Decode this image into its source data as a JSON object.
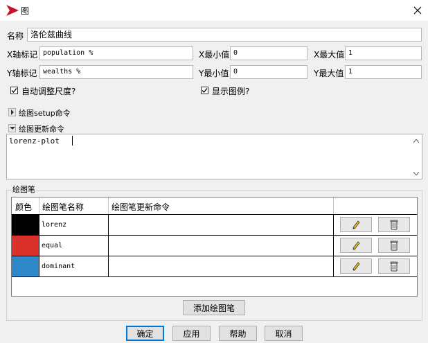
{
  "window": {
    "title": "图"
  },
  "form": {
    "name_label": "名称",
    "name_value": "洛伦兹曲线",
    "xlabel_label": "X轴标记",
    "xlabel_value": "population %",
    "xmin_label": "X最小值",
    "xmin_value": "0",
    "xmax_label": "X最大值",
    "xmax_value": "1",
    "ylabel_label": "Y轴标记",
    "ylabel_value": "wealths %",
    "ymin_label": "Y最小值",
    "ymin_value": "0",
    "ymax_label": "Y最大值",
    "ymax_value": "1",
    "autoscale_label": "自动调整尺度?",
    "autoscale_checked": true,
    "legend_label": "显示图例?",
    "legend_checked": true
  },
  "setup": {
    "label": "绘图setup命令",
    "expanded": false
  },
  "update": {
    "label": "绘图更新命令",
    "expanded": true,
    "code": "lorenz-plot"
  },
  "pens": {
    "group_label": "绘图笔",
    "headers": [
      "颜色",
      "绘图笔名称",
      "绘图笔更新命令"
    ],
    "rows": [
      {
        "color": "#000000",
        "name": "lorenz",
        "command": ""
      },
      {
        "color": "#d9302c",
        "name": "equal",
        "command": ""
      },
      {
        "color": "#2e87c7",
        "name": "dominant",
        "command": ""
      }
    ],
    "add_label": "添加绘图笔"
  },
  "buttons": {
    "ok": "确定",
    "apply": "应用",
    "help": "帮助",
    "cancel": "取消"
  },
  "icons": {
    "app": "netlogo-arrow-icon",
    "edit": "pencil-icon",
    "delete": "trash-icon",
    "close": "close-icon"
  },
  "colors": {
    "accent": "#0078d7"
  }
}
